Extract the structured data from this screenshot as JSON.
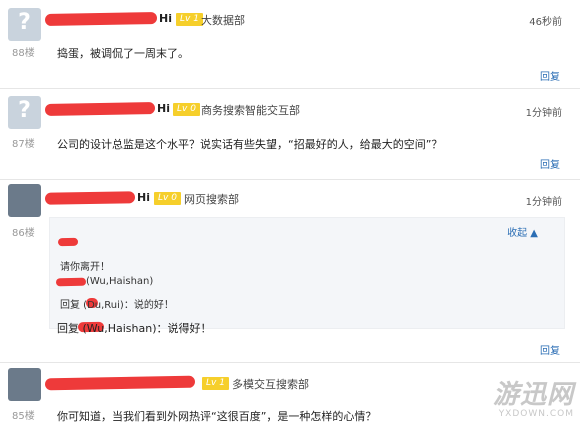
{
  "posts": [
    {
      "hi": "Hi",
      "level": "Lv 1",
      "dept": "大数据部",
      "time": "46秒前",
      "floor": "88楼",
      "content": "捣蛋，被调侃了一周末了。",
      "reply": "回复"
    },
    {
      "hi": "Hi",
      "level": "Lv 0",
      "dept": "商务搜索智能交互部",
      "time": "1分钟前",
      "floor": "87楼",
      "content": "公司的设计总监是这个水平？说实话有些失望，“招最好的人，给最大的空间”？",
      "reply": "回复"
    },
    {
      "hi": "Hi",
      "level": "Lv 0",
      "dept": "网页搜索部",
      "time": "1分钟前",
      "floor": "86楼",
      "collapse": "收起 ▲",
      "sub_replies": [
        "请你离开！",
        "(Wu,Haishan)",
        "回复 (Du,Rui)：说的好！"
      ],
      "content": "回复 (Wu,Haishan)：说得好！",
      "reply": "回复"
    },
    {
      "level": "Lv 1",
      "dept": "多模交互搜索部",
      "floor": "85楼",
      "content": "你可知道，当我们看到外网热评“这很百度”，是一种怎样的心情？"
    }
  ],
  "watermark": {
    "text": "游迅网",
    "sub": "YXDOWN.COM"
  },
  "colors": {
    "link": "#2a6db4",
    "level_badge": "#f6cf2b",
    "redaction": "#ee3a3a"
  }
}
